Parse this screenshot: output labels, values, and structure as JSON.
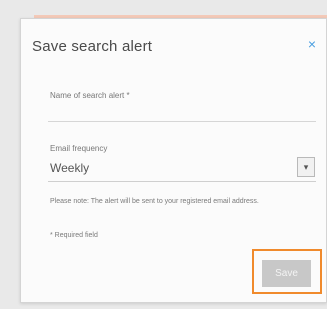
{
  "dialog": {
    "title": "Save search alert",
    "close_symbol": "×",
    "name_field": {
      "label": "Name of search alert *",
      "value": "",
      "placeholder": ""
    },
    "frequency_field": {
      "label": "Email frequency",
      "selected": "Weekly",
      "chevron_symbol": "▾"
    },
    "note": "Please note: The alert will be sent to your registered email address.",
    "required_note": "* Required field",
    "save_label": "Save"
  },
  "colors": {
    "close_icon": "#4a9fe0",
    "save_button_bg": "#c8c8c8",
    "highlight_border": "#f08a2c",
    "accent_strip": "#f3c9b8"
  },
  "icons": {
    "close": "close-icon",
    "dropdown": "chevron-down-icon"
  }
}
